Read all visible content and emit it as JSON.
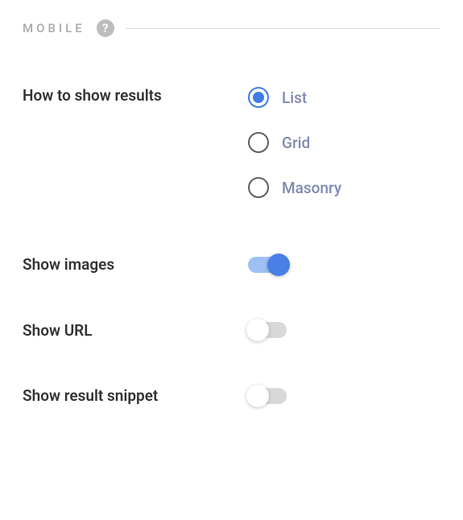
{
  "section": {
    "title": "MOBILE"
  },
  "settings": {
    "results_display": {
      "label": "How to show results",
      "options": [
        {
          "label": "List",
          "selected": true
        },
        {
          "label": "Grid",
          "selected": false
        },
        {
          "label": "Masonry",
          "selected": false
        }
      ]
    },
    "show_images": {
      "label": "Show images",
      "value": true
    },
    "show_url": {
      "label": "Show URL",
      "value": false
    },
    "show_snippet": {
      "label": "Show result snippet",
      "value": false
    }
  }
}
